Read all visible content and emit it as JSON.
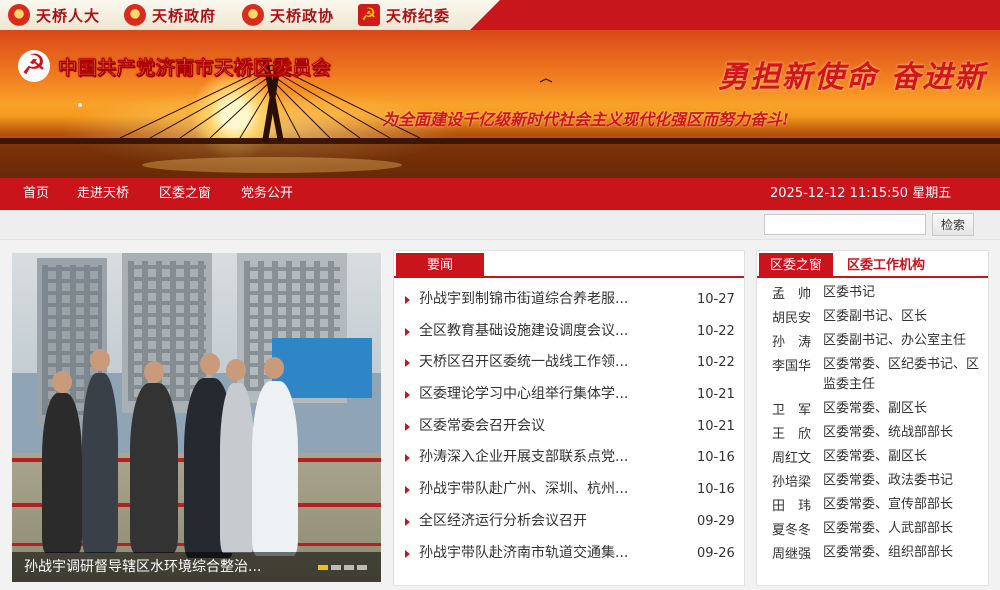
{
  "top_links": [
    {
      "label": "天桥人大",
      "icon": "national-emblem-icon"
    },
    {
      "label": "天桥政府",
      "icon": "national-emblem-icon"
    },
    {
      "label": "天桥政协",
      "icon": "cppcc-emblem-icon"
    },
    {
      "label": "天桥纪委",
      "icon": "party-emblem-icon"
    }
  ],
  "banner": {
    "site_name": "中国共产党济南市天桥区委员会",
    "slogan_main": "勇担新使命  奋进新",
    "slogan_sub": "为全面建设千亿级新时代社会主义现代化强区而努力奋斗!"
  },
  "nav": {
    "items": [
      "首页",
      "走进天桥",
      "区委之窗",
      "党务公开"
    ],
    "datetime": "2025-12-12 11:15:50 星期五"
  },
  "search": {
    "placeholder": "",
    "button_label": "检索"
  },
  "slideshow": {
    "caption": "孙战宇调研督导辖区水环境综合整治...",
    "active_index": 0,
    "slide_count": 4
  },
  "news": {
    "tab_label": "要闻",
    "items": [
      {
        "title": "孙战宇到制锦市街道综合养老服...",
        "date": "10-27"
      },
      {
        "title": "全区教育基础设施建设调度会议...",
        "date": "10-22"
      },
      {
        "title": "天桥区召开区委统一战线工作领...",
        "date": "10-22"
      },
      {
        "title": "区委理论学习中心组举行集体学...",
        "date": "10-21"
      },
      {
        "title": "区委常委会召开会议",
        "date": "10-21"
      },
      {
        "title": "孙涛深入企业开展支部联系点党...",
        "date": "10-16"
      },
      {
        "title": "孙战宇带队赴广州、深圳、杭州...",
        "date": "10-16"
      },
      {
        "title": "全区经济运行分析会议召开",
        "date": "09-29"
      },
      {
        "title": "孙战宇带队赴济南市轨道交通集...",
        "date": "09-26"
      }
    ]
  },
  "officials": {
    "tab_active": "区委之窗",
    "tab_other": "区委工作机构",
    "items": [
      {
        "name": "孟　帅",
        "role": "区委书记"
      },
      {
        "name": "胡民安",
        "role": "区委副书记、区长"
      },
      {
        "name": "孙　涛",
        "role": "区委副书记、办公室主任"
      },
      {
        "name": "李国华",
        "role": "区委常委、区纪委书记、区监委主任"
      },
      {
        "name": "卫　军",
        "role": "区委常委、副区长"
      },
      {
        "name": "王　欣",
        "role": "区委常委、统战部部长"
      },
      {
        "name": "周红文",
        "role": "区委常委、副区长"
      },
      {
        "name": "孙培梁",
        "role": "区委常委、政法委书记"
      },
      {
        "name": "田　玮",
        "role": "区委常委、宣传部部长"
      },
      {
        "name": "夏冬冬",
        "role": "区委常委、人武部部长"
      },
      {
        "name": "周继强",
        "role": "区委常委、组织部部长"
      }
    ]
  },
  "colors": {
    "brand_red": "#c9141c",
    "text": "#333333"
  }
}
